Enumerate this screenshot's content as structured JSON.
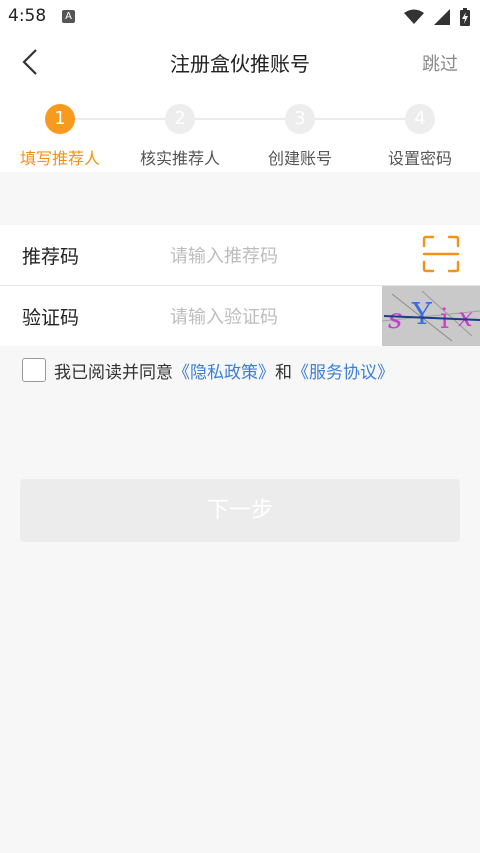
{
  "status_bar": {
    "time": "4:58",
    "notification_icon": "A"
  },
  "nav": {
    "title": "注册盒伙推账号",
    "skip_label": "跳过"
  },
  "steps": [
    {
      "number": "1",
      "label": "填写推荐人",
      "active": true
    },
    {
      "number": "2",
      "label": "核实推荐人",
      "active": false
    },
    {
      "number": "3",
      "label": "创建账号",
      "active": false
    },
    {
      "number": "4",
      "label": "设置密码",
      "active": false
    }
  ],
  "form": {
    "referral_label": "推荐码",
    "referral_placeholder": "请输入推荐码",
    "captcha_label": "验证码",
    "captcha_placeholder": "请输入验证码",
    "captcha_text": "sYix"
  },
  "agreement": {
    "prefix": "我已阅读并同意",
    "privacy_link": "《隐私政策》",
    "conjunction": "和",
    "service_link": "《服务协议》"
  },
  "next_button_label": "下一步",
  "colors": {
    "accent": "#f79a1d",
    "link": "#3b7fd6",
    "disabled_button": "#ececec"
  }
}
